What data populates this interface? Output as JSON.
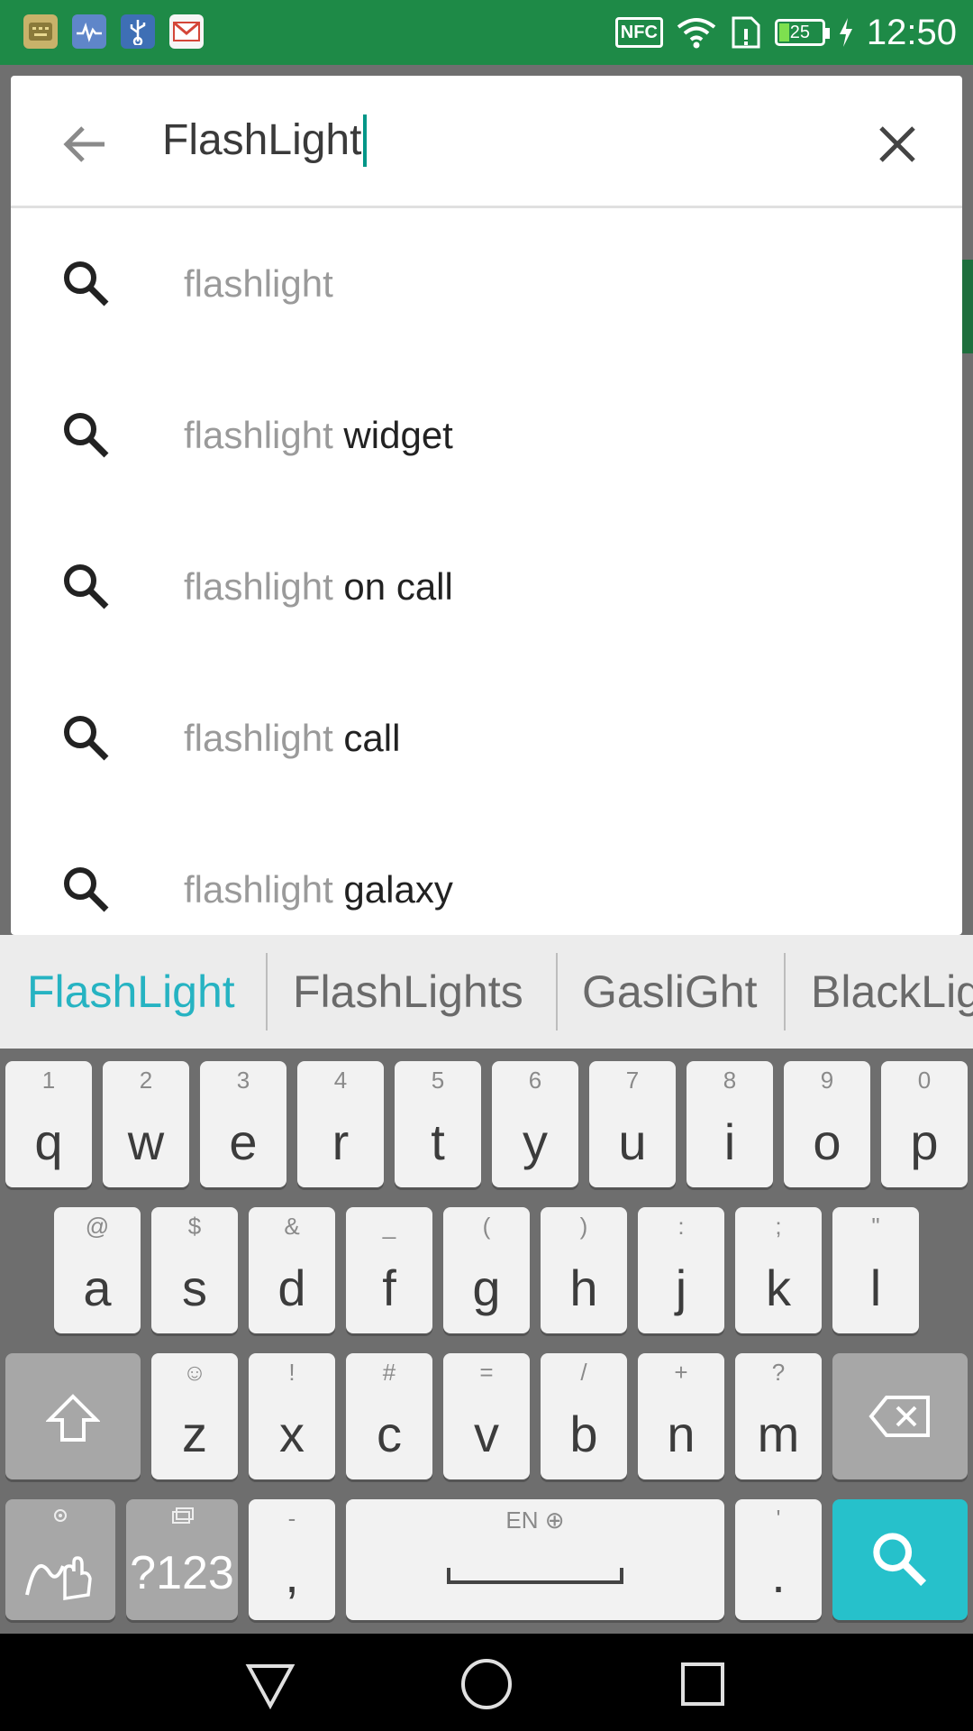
{
  "status_bar": {
    "nfc": "NFC",
    "battery_level": "25",
    "time": "12:50",
    "icons": [
      "keyboard-notif-icon",
      "health-notif-icon",
      "usb-icon",
      "gmail-icon",
      "nfc-icon",
      "wifi-icon",
      "sim-icon",
      "battery-icon",
      "charging-icon"
    ]
  },
  "search": {
    "query": "FlashLight",
    "back_icon": "arrow-left-icon",
    "clear_icon": "close-icon"
  },
  "suggestions": [
    {
      "prefix": "flashlight",
      "suffix": ""
    },
    {
      "prefix": "flashlight",
      "suffix": " widget"
    },
    {
      "prefix": "flashlight",
      "suffix": " on call"
    },
    {
      "prefix": "flashlight",
      "suffix": " call"
    },
    {
      "prefix": "flashlight",
      "suffix": " galaxy"
    }
  ],
  "keyboard": {
    "candidates": [
      "FlashLight",
      "FlashLights",
      "GasliGht",
      "BlackLig"
    ],
    "row1": [
      {
        "main": "q",
        "sub": "1"
      },
      {
        "main": "w",
        "sub": "2"
      },
      {
        "main": "e",
        "sub": "3"
      },
      {
        "main": "r",
        "sub": "4"
      },
      {
        "main": "t",
        "sub": "5"
      },
      {
        "main": "y",
        "sub": "6"
      },
      {
        "main": "u",
        "sub": "7"
      },
      {
        "main": "i",
        "sub": "8"
      },
      {
        "main": "o",
        "sub": "9"
      },
      {
        "main": "p",
        "sub": "0"
      }
    ],
    "row2": [
      {
        "main": "a",
        "sub": "@"
      },
      {
        "main": "s",
        "sub": "$"
      },
      {
        "main": "d",
        "sub": "&"
      },
      {
        "main": "f",
        "sub": "_"
      },
      {
        "main": "g",
        "sub": "("
      },
      {
        "main": "h",
        "sub": ")"
      },
      {
        "main": "j",
        "sub": ":"
      },
      {
        "main": "k",
        "sub": ";"
      },
      {
        "main": "l",
        "sub": "\""
      }
    ],
    "row3": [
      {
        "main": "z",
        "sub": "☺"
      },
      {
        "main": "x",
        "sub": "!"
      },
      {
        "main": "c",
        "sub": "#"
      },
      {
        "main": "v",
        "sub": "="
      },
      {
        "main": "b",
        "sub": "/"
      },
      {
        "main": "n",
        "sub": "+"
      },
      {
        "main": "m",
        "sub": "?"
      }
    ],
    "symbols_label": "?123",
    "comma": {
      "main": ",",
      "sub": "-"
    },
    "space_lang": "EN",
    "period": {
      "main": ".",
      "sub": "'"
    },
    "accent_color": "#26c1cb"
  },
  "navbar": {
    "icons": [
      "back-triangle-icon",
      "home-circle-icon",
      "recents-square-icon"
    ]
  }
}
